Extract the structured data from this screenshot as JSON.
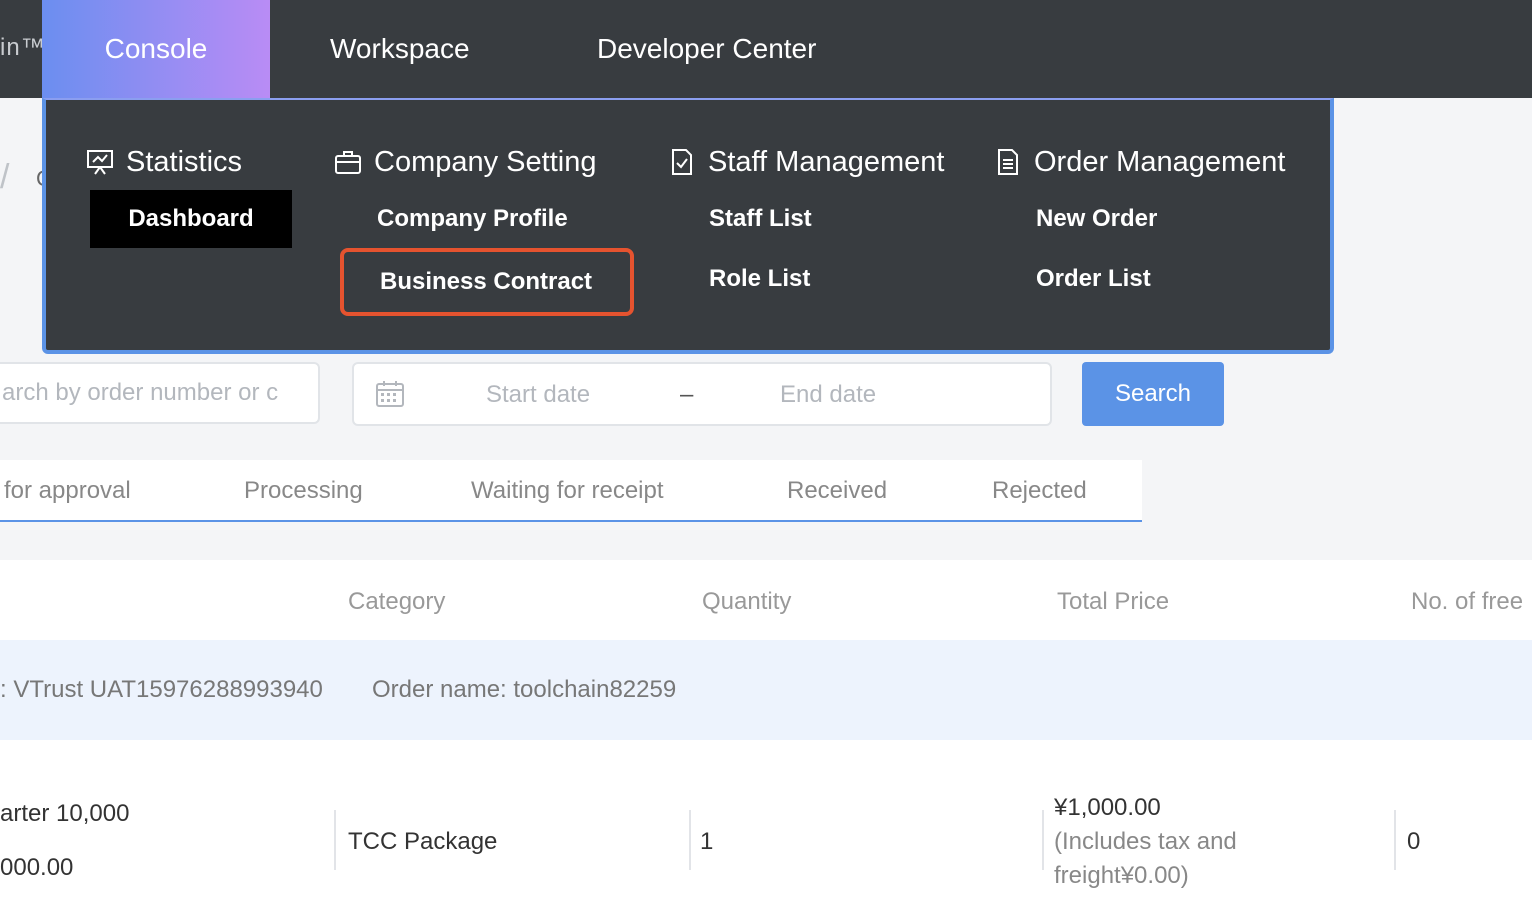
{
  "topnav": {
    "logo_fragment": "in™",
    "items": [
      {
        "label": "Console"
      },
      {
        "label": "Workspace"
      },
      {
        "label": "Developer Center"
      }
    ]
  },
  "menu": {
    "columns": [
      {
        "title": "Statistics",
        "icon": "presentation-icon",
        "links": [
          "Dashboard"
        ]
      },
      {
        "title": "Company Setting",
        "icon": "briefcase-icon",
        "links": [
          "Company Profile",
          "Business Contract"
        ]
      },
      {
        "title": "Staff Management",
        "icon": "checklist-icon",
        "links": [
          "Staff List",
          "Role List"
        ]
      },
      {
        "title": "Order Management",
        "icon": "document-icon",
        "links": [
          "New Order",
          "Order List"
        ]
      }
    ],
    "highlight_color": "#e5532f",
    "accent_color": "#5b93e6"
  },
  "breadcrumb": {
    "separator": "/",
    "fragment": "C"
  },
  "filters": {
    "search_placeholder": "Search by order number or c",
    "search_visible": "arch by order number or c",
    "start_placeholder": "Start date",
    "dash": "–",
    "end_placeholder": "End date",
    "search_button": "Search"
  },
  "tabs": [
    "for approval",
    "Processing",
    "Waiting for receipt",
    "Received",
    "Rejected"
  ],
  "table": {
    "headers": [
      "Category",
      "Quantity",
      "Total Price",
      "No. of free"
    ],
    "group": {
      "company": ": VTrust UAT15976288993940",
      "order_name": "Order name: toolchain82259"
    },
    "row": {
      "name_line1": "arter 10,000",
      "name_line2": "000.00",
      "category": "TCC Package",
      "quantity": "1",
      "price": "¥1,000.00",
      "price_note_1": "(Includes tax and",
      "price_note_2": "freight¥0.00)",
      "free": "0"
    }
  }
}
